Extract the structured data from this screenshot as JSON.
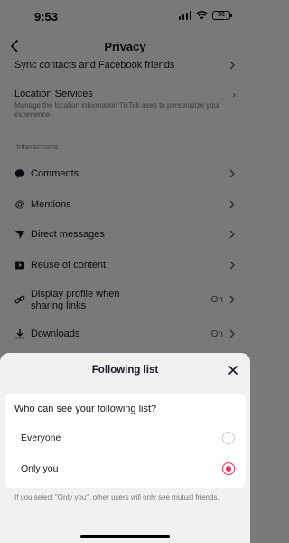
{
  "status_bar": {
    "time": "9:53",
    "battery": "36"
  },
  "nav": {
    "title": "Privacy"
  },
  "rows": {
    "sync": {
      "label": "Sync contacts and Facebook friends"
    },
    "location": {
      "label": "Location Services",
      "desc": "Manage the location information TikTok uses to personalize your experience"
    },
    "interactions_header": "Interactions",
    "comments": {
      "label": "Comments",
      "icon": "comment-icon"
    },
    "mentions": {
      "label": "Mentions",
      "icon": "at-icon"
    },
    "direct": {
      "label": "Direct messages",
      "icon": "send-icon"
    },
    "reuse": {
      "label": "Reuse of content",
      "icon": "video-icon"
    },
    "links": {
      "label_line1": "Display profile when",
      "label_line2": "sharing links",
      "status": "On",
      "icon": "link-icon"
    },
    "downloads": {
      "label": "Downloads",
      "status": "On",
      "icon": "download-icon"
    }
  },
  "sheet": {
    "title": "Following list",
    "question": "Who can see your following list?",
    "options": [
      {
        "label": "Everyone",
        "selected": false
      },
      {
        "label": "Only you",
        "selected": true
      }
    ],
    "footnote": "If you select \"Only you\", other users will only see mutual friends."
  },
  "colors": {
    "accent": "#fe2c55",
    "sheet_bg": "#f1f1f2"
  }
}
